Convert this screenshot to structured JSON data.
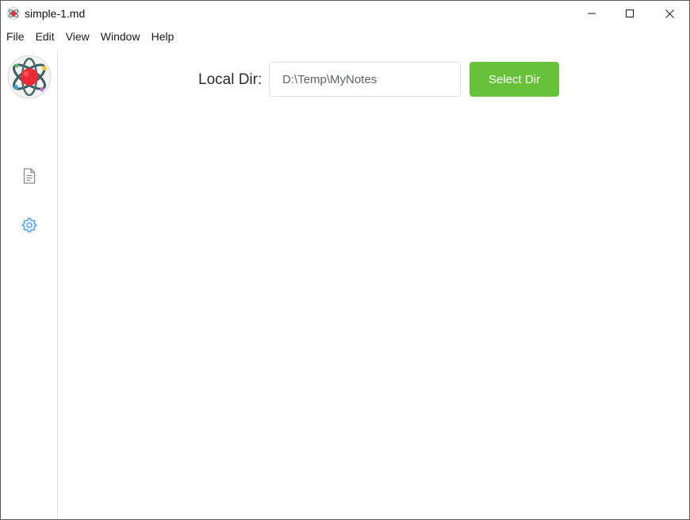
{
  "window": {
    "title": "simple-1.md",
    "controls": {
      "minimize": "minimize-icon",
      "maximize": "maximize-icon",
      "close": "close-icon"
    }
  },
  "menu": {
    "items": [
      "File",
      "Edit",
      "View",
      "Window",
      "Help"
    ]
  },
  "sidebar": {
    "logo": "atom-logo",
    "items": [
      {
        "icon": "document-icon",
        "active": false
      },
      {
        "icon": "gear-icon",
        "active": true
      }
    ]
  },
  "settings": {
    "local_dir_label": "Local Dir:",
    "dir_value": "D:\\Temp\\MyNotes",
    "select_button": "Select Dir"
  },
  "colors": {
    "accent_green": "#67c23a",
    "active_icon": "#409eff",
    "inactive_icon": "#8a8a8a"
  }
}
